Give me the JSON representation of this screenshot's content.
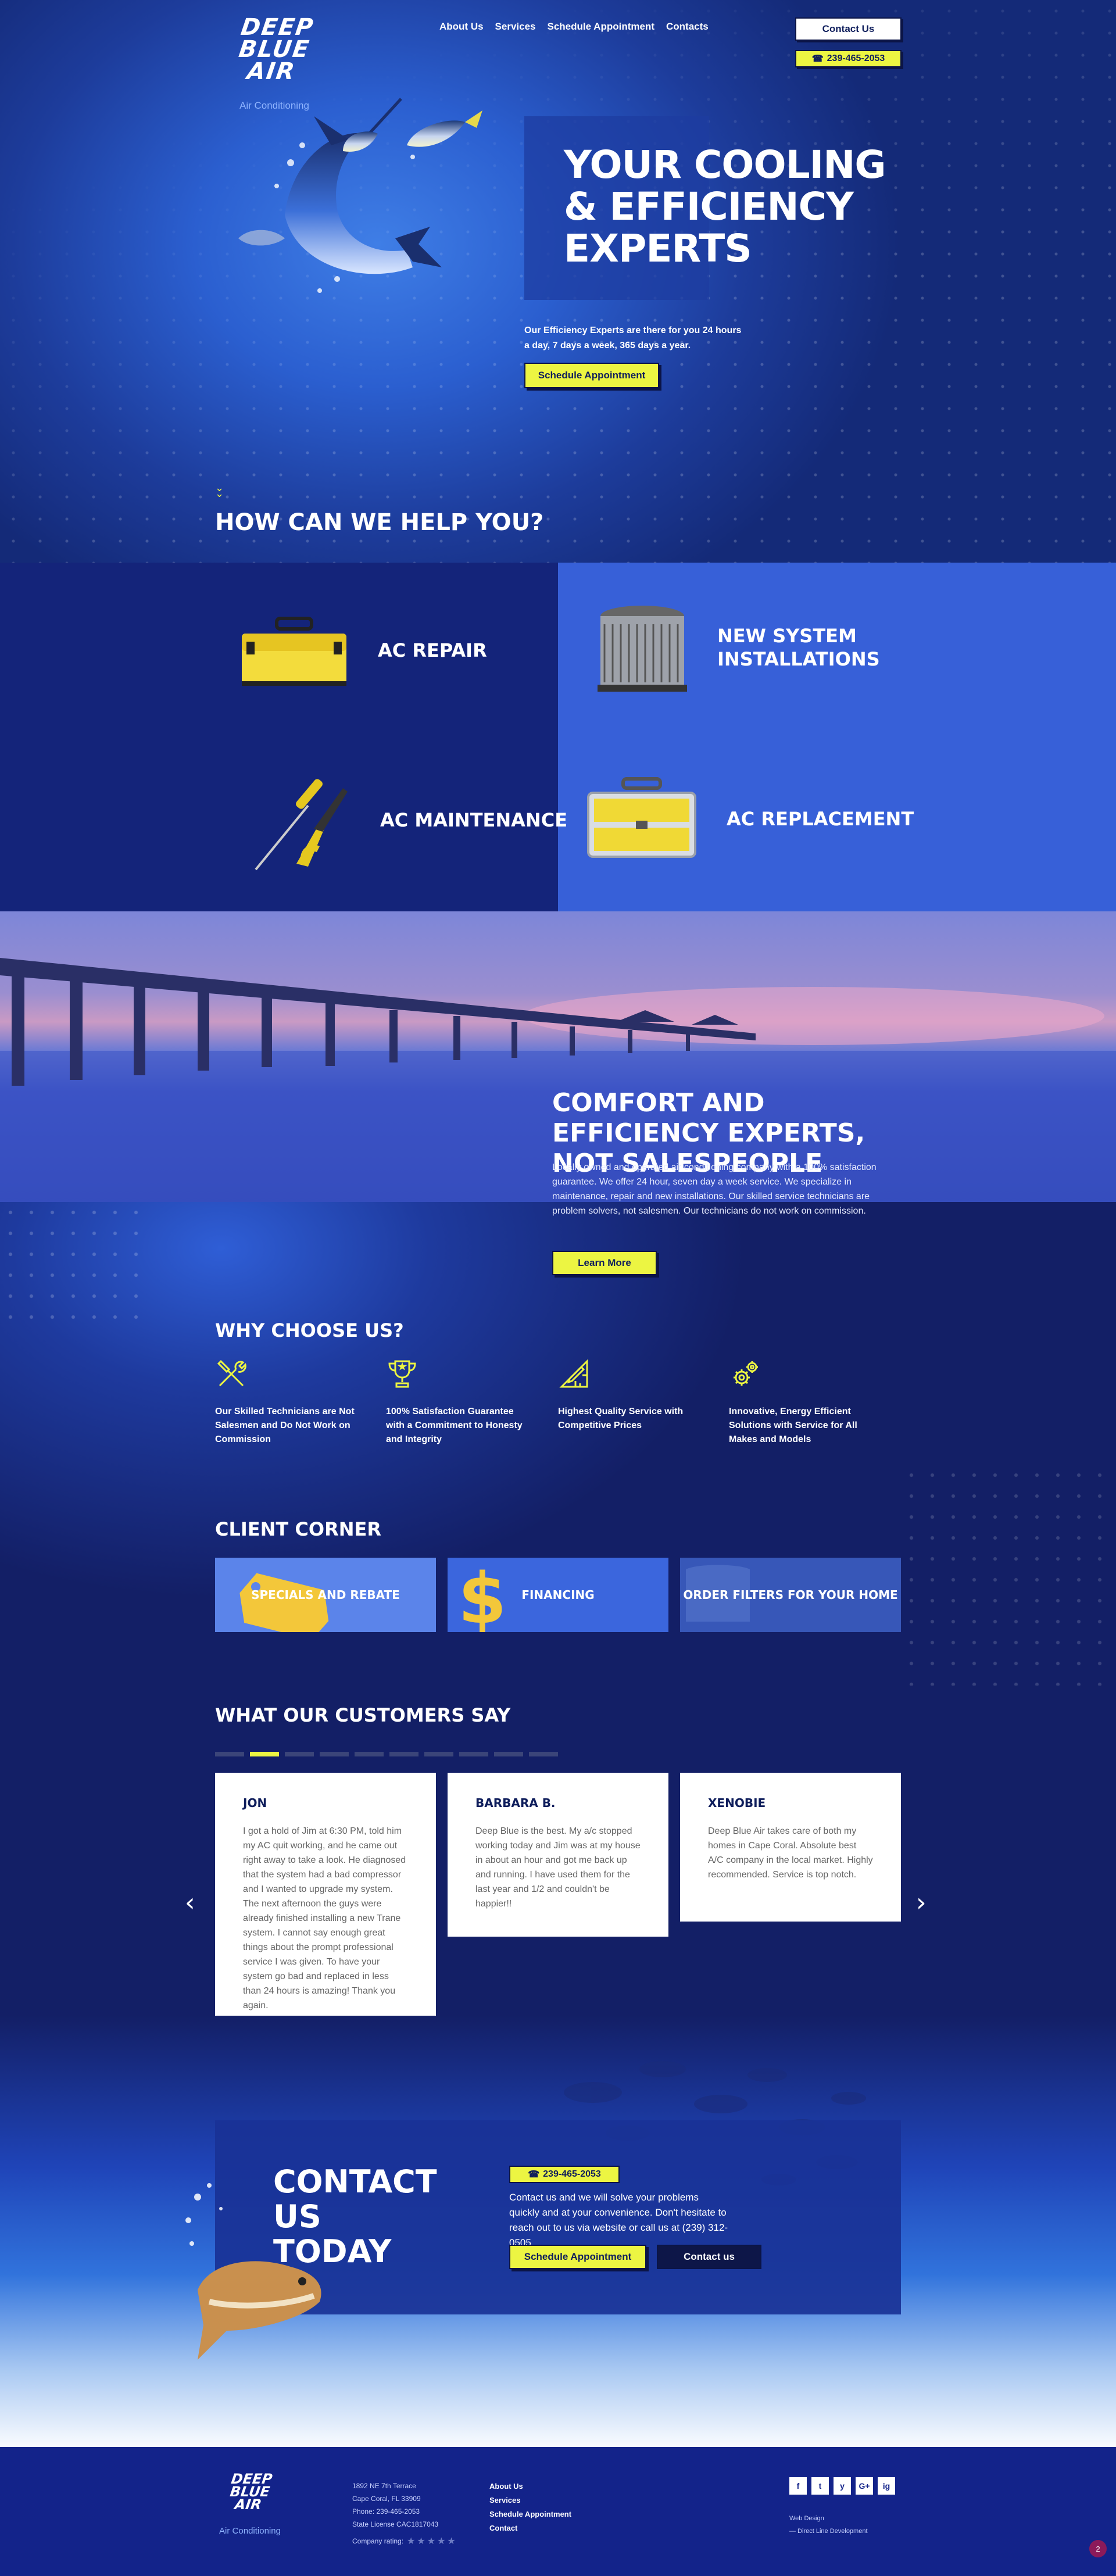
{
  "brand": {
    "logo_line1": "DEEP",
    "logo_line2": "BLUE",
    "logo_line3": "AIR",
    "tagline": "Air Conditioning"
  },
  "nav": {
    "about": "About Us",
    "services": "Services",
    "schedule": "Schedule Appointment",
    "contacts": "Contacts"
  },
  "header": {
    "contact_button": "Contact Us",
    "phone": "239-465-2053"
  },
  "hero": {
    "title": "YOUR COOLING & EFFICIENCY EXPERTS",
    "text": "Our Efficiency Experts are there for you 24 hours a day, 7 days a week, 365 days a year.",
    "button": "Schedule Appointment",
    "help_heading": "HOW CAN WE HELP YOU?"
  },
  "services": [
    {
      "label": "AC REPAIR",
      "icon": "toolbox-icon"
    },
    {
      "label": "NEW SYSTEM INSTALLATIONS",
      "icon": "ac-unit-icon"
    },
    {
      "label": "AC MAINTENANCE",
      "icon": "tools-icon"
    },
    {
      "label": "AC REPLACEMENT",
      "icon": "toolcase-icon"
    }
  ],
  "comfort": {
    "title": "COMFORT AND EFFICIENCY EXPERTS, NOT SALESPEOPLE",
    "text": "Locally owned and operated air conditioning company with a 100% satisfaction guarantee. We offer 24 hour, seven day a week service. We specialize in maintenance, repair and new installations. Our skilled service technicians are problem solvers, not salesmen. Our technicians do not work on commission.",
    "button": "Learn More"
  },
  "why": {
    "heading": "WHY CHOOSE US?",
    "items": [
      {
        "text": "Our Skilled Technicians are Not Salesmen and Do Not Work on Commission",
        "icon": "wrench-screwdriver-icon"
      },
      {
        "text": "100% Satisfaction Guarantee with a Commitment to Honesty and Integrity",
        "icon": "trophy-icon"
      },
      {
        "text": "Highest Quality Service with Competitive Prices",
        "icon": "ruler-pencil-icon"
      },
      {
        "text": "Innovative, Energy Efficient Solutions with Service for All Makes and Models",
        "icon": "gears-icon"
      }
    ]
  },
  "client_corner": {
    "heading": "CLIENT CORNER",
    "cards": [
      {
        "label": "SPECIALS AND REBATE"
      },
      {
        "label": "FINANCING"
      },
      {
        "label": "ORDER FILTERS FOR YOUR HOME"
      }
    ]
  },
  "testimonials": {
    "heading": "WHAT OUR CUSTOMERS SAY",
    "active_dot": 1,
    "dot_count": 10,
    "items": [
      {
        "name": "JON",
        "text": "I got a hold of Jim at 6:30 PM, told him my AC quit working, and he came out right away to take a look. He diagnosed that the system had a bad compressor and I wanted to upgrade my system. The next afternoon the guys were already finished installing a new Trane system. I cannot say enough great things about the prompt professional service I was given. To have your system go bad and replaced in less than 24 hours is amazing! Thank you again."
      },
      {
        "name": "BARBARA B.",
        "text": "Deep Blue is the best. My a/c stopped working today and Jim was at my house in about an hour and got me back up and running. I have used them for the last year and 1/2 and couldn't be happier!!"
      },
      {
        "name": "XENOBIE",
        "text": "Deep Blue Air takes care of both my homes in Cape Coral. Absolute best A/C company in the local market. Highly recommended. Service is top notch."
      }
    ]
  },
  "contact": {
    "title": "CONTACT US TODAY",
    "phone": "239-465-2053",
    "text": "Contact us and we will solve your problems quickly and at your convenience. Don't hesitate to reach out to us via website or call us at (239) 312-0505",
    "btn_schedule": "Schedule Appointment",
    "btn_contact": "Contact us"
  },
  "footer": {
    "address1": "1892 NE 7th Terrace",
    "address2": "Cape Coral, FL 33909",
    "phone": "Phone: 239-465-2053",
    "license": "State License CAC1817043",
    "rating_label": "Company rating:",
    "nav": [
      "About Us",
      "Services",
      "Schedule Appointment",
      "Contact"
    ],
    "social": [
      "f",
      "t",
      "y",
      "G+",
      "ig"
    ],
    "credit1": "Web Design",
    "credit2": "— Direct Line Development",
    "badge": "2"
  },
  "colors": {
    "accent_yellow": "#ecf542",
    "navy": "#13236e",
    "royal": "#3760d8"
  }
}
